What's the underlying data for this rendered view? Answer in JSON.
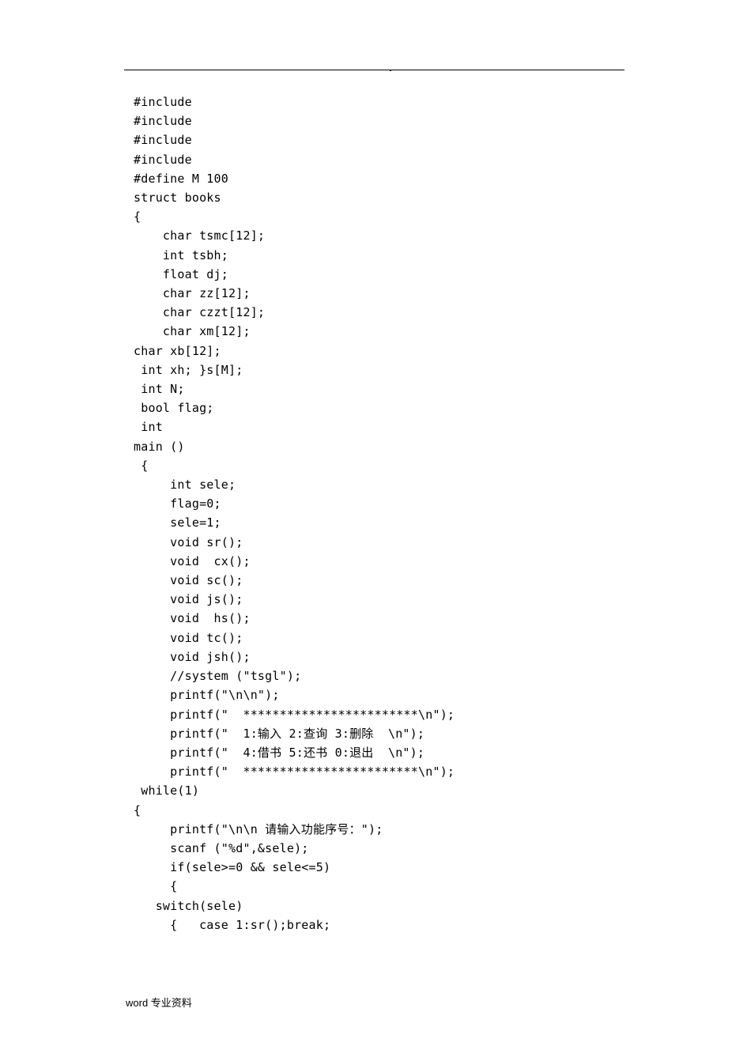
{
  "header_dot": ".",
  "code": {
    "lines": [
      "#include",
      "#include",
      "#include",
      "#include",
      "#define M 100",
      "struct books",
      "{",
      "    char tsmc[12];",
      "    int tsbh;",
      "    float dj;",
      "    char zz[12];",
      "    char czzt[12];",
      "    char xm[12];",
      "char xb[12];",
      " int xh; }s[M];",
      " int N;",
      " bool flag;",
      " int",
      "main ()",
      " {",
      "     int sele;",
      "     flag=0;",
      "     sele=1;",
      "     void sr();",
      "     void  cx();",
      "     void sc();",
      "     void js();",
      "     void  hs();",
      "     void tc();",
      "     void jsh();",
      "     //system (\"tsgl\");",
      "     printf(\"\\n\\n\");",
      "     printf(\"  ************************\\n\");",
      "     printf(\"  1:输入 2:查询 3:删除  \\n\");",
      "     printf(\"  4:借书 5:还书 0:退出  \\n\");",
      "     printf(\"  ************************\\n\");",
      " while(1)",
      "{",
      "     printf(\"\\n\\n 请输入功能序号：\");",
      "     scanf (\"%d\",&sele);",
      "     if(sele>=0 && sele<=5)",
      "     {",
      "   switch(sele)",
      "     {   case 1:sr();break;"
    ]
  },
  "footer": "word 专业资料"
}
